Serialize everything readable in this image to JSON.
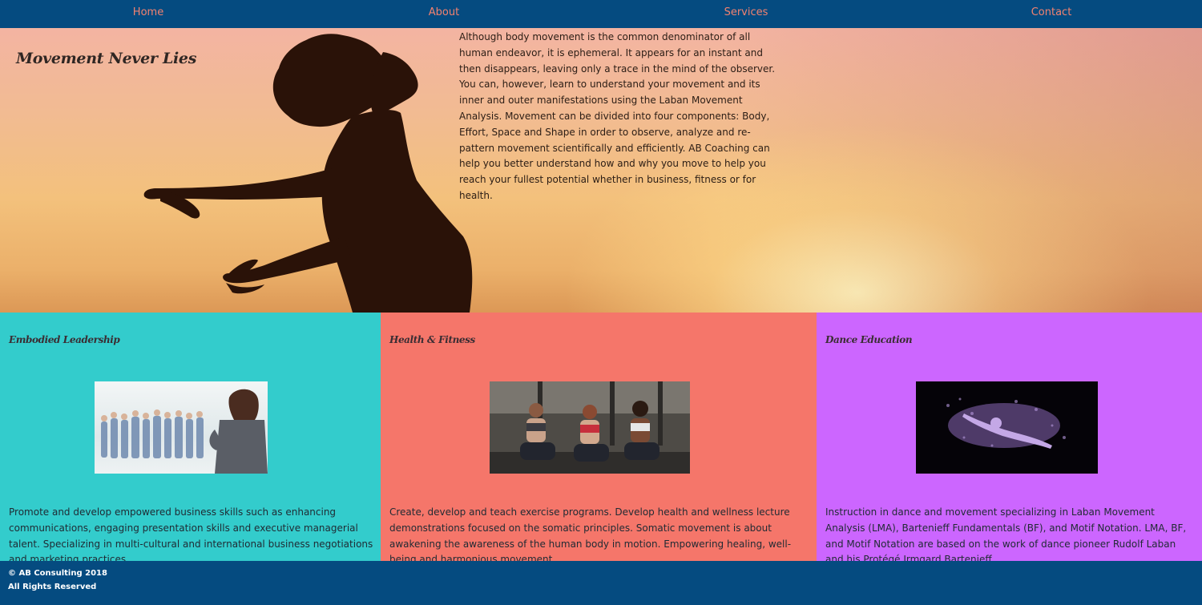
{
  "nav": {
    "items": [
      {
        "label": "Home"
      },
      {
        "label": "About"
      },
      {
        "label": "Services"
      },
      {
        "label": "Contact"
      }
    ],
    "link_color": "#f3826f",
    "background": "#054b80"
  },
  "hero": {
    "title": "Movement Never Lies",
    "body": "Although body movement is the common denominator of all human endeavor, it is ephemeral. It appears for an instant and then disappears, leaving only a trace in the mind of the observer. You can, however, learn to understand your movement and its inner and outer manifestations using the Laban Movement Analysis. Movement can be divided into four components: Body, Effort, Space and Shape in order to observe, analyze and re-pattern movement scientifically and efficiently. AB Coaching can help you better understand how and why you move to help you reach your fullest potential whether in business, fitness or for health."
  },
  "services": [
    {
      "title": "Embodied Leadership",
      "background": "#33cccc",
      "body": "Promote and develop empowered business skills such as enhancing communications, engaging presentation skills and executive managerial talent. Specializing in multi-cultural and international business negotiations and marketing practices."
    },
    {
      "title": "Health & Fitness",
      "background": "#f5766a",
      "body": "Create, develop and teach exercise programs. Develop health and wellness lecture demonstrations focused on the somatic principles. Somatic movement is about awakening the awareness of the human body in motion. Empowering healing, well-being and harmonious movement."
    },
    {
      "title": "Dance Education",
      "background": "#cc66ff",
      "body": "Instruction in dance and movement specializing in Laban Movement Analysis (LMA), Bartenieff Fundamentals (BF), and Motif Notation. LMA, BF, and Motif Notation are based on the work of dance pioneer Rudolf Laban and his Protégé Irmgard Bartenieff."
    }
  ],
  "footer": {
    "copyright": "© AB Consulting 2018",
    "rights": "All Rights Reserved"
  }
}
